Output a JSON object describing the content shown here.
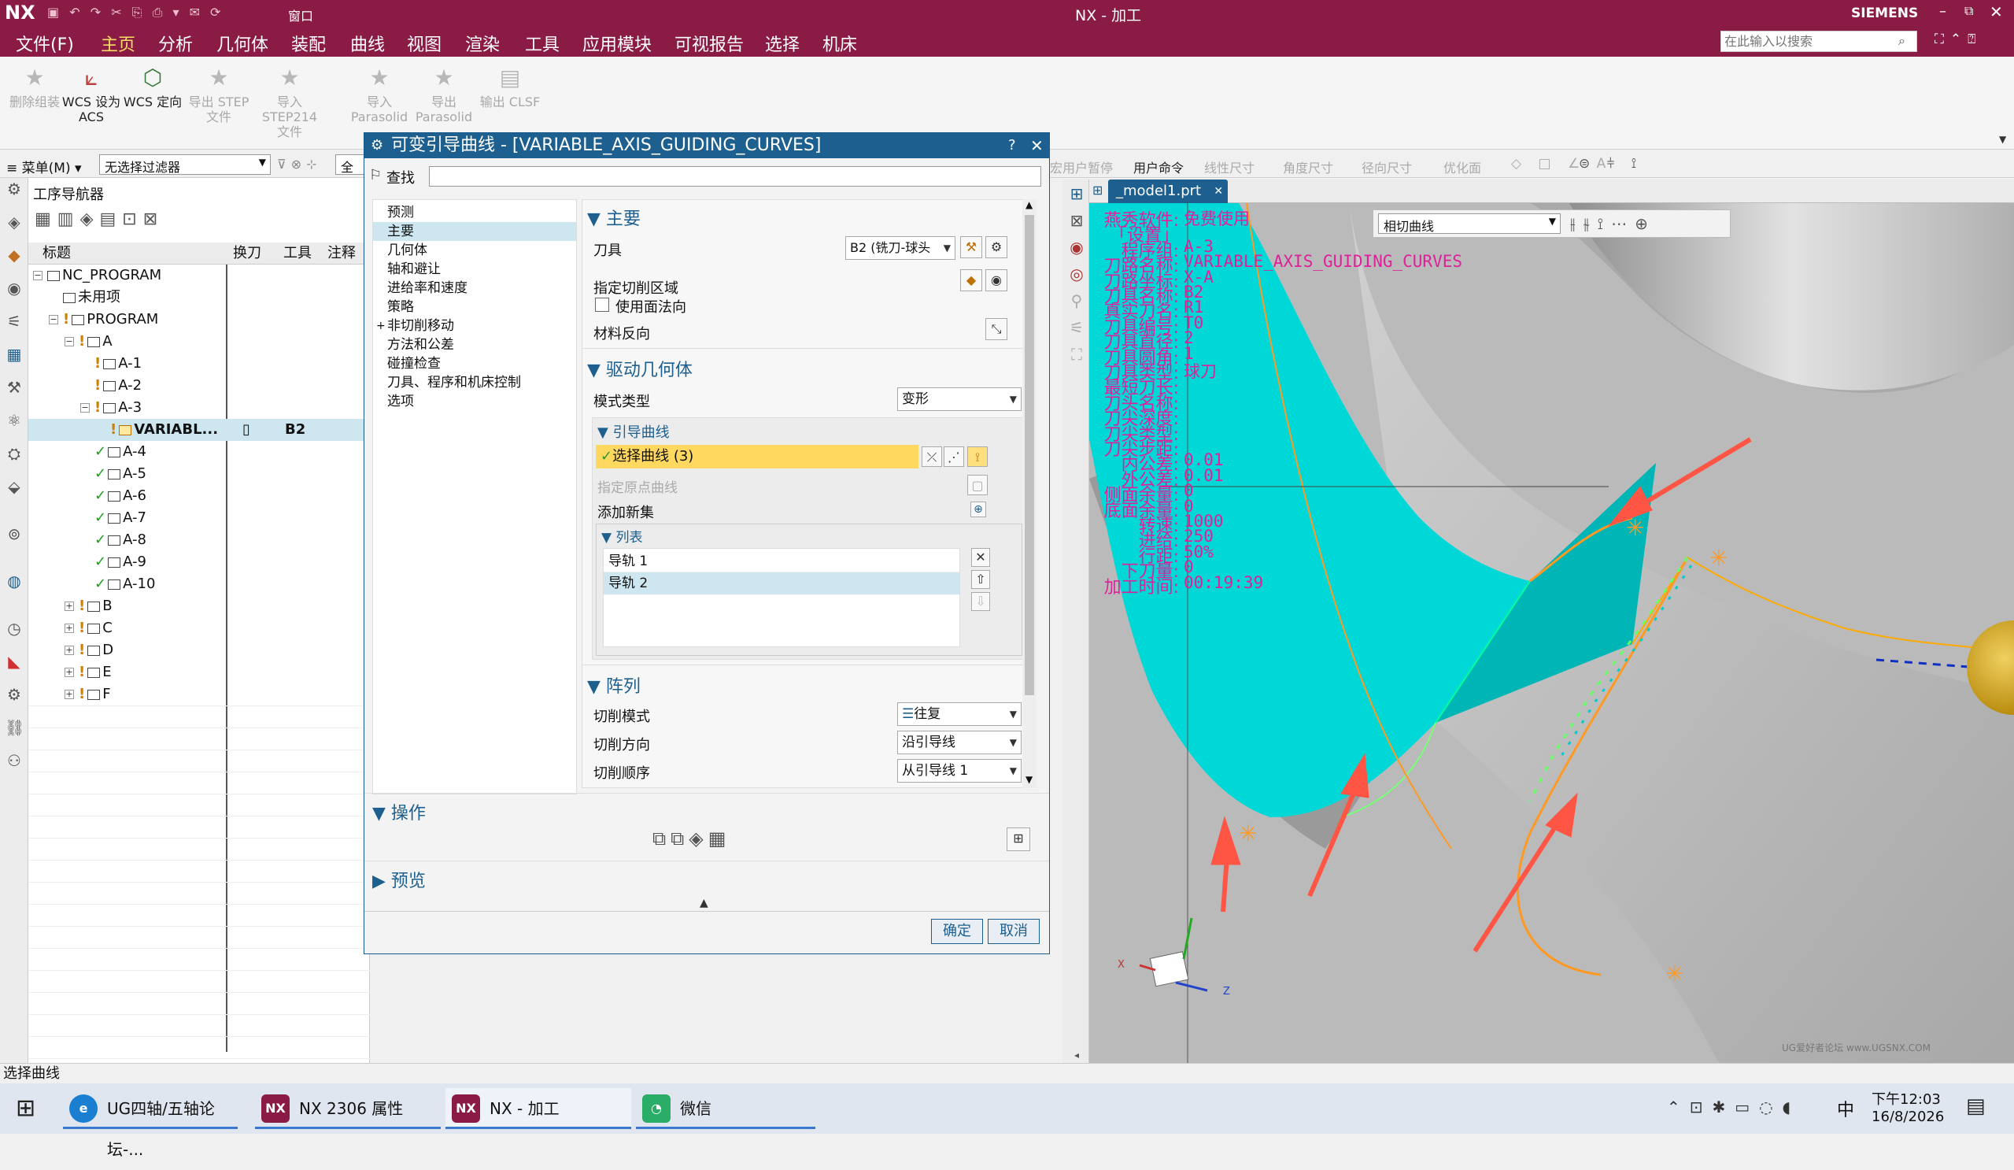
{
  "title": {
    "logo": "NX",
    "window_title": "NX - 加工",
    "brand": "SIEMENS",
    "window_menu": "窗口"
  },
  "menubar": {
    "items": [
      "文件(F)",
      "主页",
      "分析",
      "几何体",
      "装配",
      "曲线",
      "视图",
      "渲染",
      "工具",
      "应用模块",
      "可视报告",
      "选择",
      "机床"
    ],
    "search_placeholder": "在此输入以搜索"
  },
  "ribbon": {
    "buttons": [
      {
        "label": "删除组装",
        "icon": "star-icon",
        "enabled": false
      },
      {
        "label": "WCS 设为 ACS",
        "icon": "wcs-icon",
        "enabled": true
      },
      {
        "label": "WCS 定向",
        "icon": "wcs-orient-icon",
        "enabled": true
      },
      {
        "label": "导出 STEP 文件",
        "icon": "star-icon",
        "enabled": false
      },
      {
        "label": "导入 STEP214 文件",
        "icon": "star-icon",
        "enabled": false
      },
      {
        "label": "导入 Parasolid",
        "icon": "star-icon",
        "enabled": false
      },
      {
        "label": "导出 Parasolid",
        "icon": "star-icon",
        "enabled": false
      },
      {
        "label": "输出 CLSF",
        "icon": "clsf-icon",
        "enabled": false
      }
    ]
  },
  "filterbar": {
    "menu": "菜单(M)",
    "filter": "无选择过滤器",
    "scope": "全部",
    "right_items": [
      "宏用户暂停",
      "用户命令",
      "线性尺寸",
      "角度尺寸",
      "径向尺寸",
      "优化面"
    ]
  },
  "navigator": {
    "title": "工序导航器",
    "columns": [
      "标题",
      "换刀",
      "工具",
      "注释"
    ],
    "rows": [
      {
        "label": "NC_PROGRAM",
        "indent": 0,
        "toggle": "−",
        "mark": "",
        "tool": "",
        "change": ""
      },
      {
        "label": "未用项",
        "indent": 1,
        "toggle": "",
        "mark": "",
        "tool": "",
        "change": ""
      },
      {
        "label": "PROGRAM",
        "indent": 1,
        "toggle": "−",
        "mark": "!",
        "tool": "",
        "change": ""
      },
      {
        "label": "A",
        "indent": 2,
        "toggle": "−",
        "mark": "!",
        "tool": "",
        "change": ""
      },
      {
        "label": "A-1",
        "indent": 3,
        "toggle": "",
        "mark": "!",
        "tool": "",
        "change": ""
      },
      {
        "label": "A-2",
        "indent": 3,
        "toggle": "",
        "mark": "!",
        "tool": "",
        "change": ""
      },
      {
        "label": "A-3",
        "indent": 3,
        "toggle": "−",
        "mark": "!",
        "tool": "",
        "change": ""
      },
      {
        "label": "VARIABL...",
        "indent": 4,
        "toggle": "",
        "mark": "!",
        "tool": "B2",
        "change": "▯",
        "selected": true
      },
      {
        "label": "A-4",
        "indent": 3,
        "toggle": "",
        "mark": "✓",
        "tool": "",
        "change": ""
      },
      {
        "label": "A-5",
        "indent": 3,
        "toggle": "",
        "mark": "✓",
        "tool": "",
        "change": ""
      },
      {
        "label": "A-6",
        "indent": 3,
        "toggle": "",
        "mark": "✓",
        "tool": "",
        "change": ""
      },
      {
        "label": "A-7",
        "indent": 3,
        "toggle": "",
        "mark": "✓",
        "tool": "",
        "change": ""
      },
      {
        "label": "A-8",
        "indent": 3,
        "toggle": "",
        "mark": "✓",
        "tool": "",
        "change": ""
      },
      {
        "label": "A-9",
        "indent": 3,
        "toggle": "",
        "mark": "✓",
        "tool": "",
        "change": ""
      },
      {
        "label": "A-10",
        "indent": 3,
        "toggle": "",
        "mark": "✓",
        "tool": "",
        "change": ""
      },
      {
        "label": "B",
        "indent": 2,
        "toggle": "+",
        "mark": "!",
        "tool": "",
        "change": ""
      },
      {
        "label": "C",
        "indent": 2,
        "toggle": "+",
        "mark": "!",
        "tool": "",
        "change": ""
      },
      {
        "label": "D",
        "indent": 2,
        "toggle": "+",
        "mark": "!",
        "tool": "",
        "change": ""
      },
      {
        "label": "E",
        "indent": 2,
        "toggle": "+",
        "mark": "!",
        "tool": "",
        "change": ""
      },
      {
        "label": "F",
        "indent": 2,
        "toggle": "+",
        "mark": "!",
        "tool": "",
        "change": ""
      }
    ]
  },
  "dialog": {
    "title": "可变引导曲线 - [VARIABLE_AXIS_GUIDING_CURVES]",
    "search_label": "查找",
    "nav_items": [
      "预测",
      "主要",
      "几何体",
      "轴和避让",
      "进给率和速度",
      "策略",
      "非切削移动",
      "方法和公差",
      "碰撞检查",
      "刀具、程序和机床控制",
      "选项"
    ],
    "main": {
      "header": "主要",
      "tool_label": "刀具",
      "tool_value": "B2 (铣刀-球头",
      "cut_region": "指定切削区域",
      "use_face_normal": "使用面法向",
      "material_reverse": "材料反向"
    },
    "drive": {
      "header": "驱动几何体",
      "mode_label": "模式类型",
      "mode_value": "变形",
      "guide_header": "引导曲线",
      "select_curve": "选择曲线 (3)",
      "origin_curve": "指定原点曲线",
      "add_new_set": "添加新集",
      "list_header": "列表",
      "list_items": [
        "导轨  1",
        "导轨  2"
      ]
    },
    "array": {
      "header": "阵列",
      "cut_mode_label": "切削模式",
      "cut_mode_value": "往复",
      "cut_dir_label": "切削方向",
      "cut_dir_value": "沿引导线",
      "cut_order_label": "切削顺序",
      "cut_order_value": "从引导线 1"
    },
    "ops_header": "操作",
    "preview_header": "预览",
    "ok": "确定",
    "cancel": "取消"
  },
  "graphics": {
    "tab": "_model1.prt",
    "filter_dropdown": "相切曲线",
    "info": [
      {
        "k": "燕秀软件:",
        "v": "免费使用"
      },
      {
        "k": "「设置」",
        "v": ""
      },
      {
        "k": "程序组:",
        "v": "A-3"
      },
      {
        "k": "刀路名称:",
        "v": "VARIABLE_AXIS_GUIDING_CURVES"
      },
      {
        "k": "刀路坐标:",
        "v": "X-A"
      },
      {
        "k": "刀具名称:",
        "v": "B2"
      },
      {
        "k": "真实刀名:",
        "v": "R1"
      },
      {
        "k": "刀具编号:",
        "v": "T0"
      },
      {
        "k": "刀具直径:",
        "v": "2"
      },
      {
        "k": "刀具圆角:",
        "v": "1"
      },
      {
        "k": "刀具类型:",
        "v": "球刀"
      },
      {
        "k": "最短刀长:",
        "v": ""
      },
      {
        "k": "刀头名称:",
        "v": ""
      },
      {
        "k": "刀尖深度:",
        "v": ""
      },
      {
        "k": "刀尖类型:",
        "v": ""
      },
      {
        "k": "刀尖步距:",
        "v": ""
      },
      {
        "k": "内公差:",
        "v": "0.01"
      },
      {
        "k": "外公差:",
        "v": "0.01"
      },
      {
        "k": "侧面余量:",
        "v": "0"
      },
      {
        "k": "底面余量:",
        "v": "0"
      },
      {
        "k": "转速:",
        "v": "1000"
      },
      {
        "k": "进给:",
        "v": "250"
      },
      {
        "k": "行距:",
        "v": "50%"
      },
      {
        "k": "下刀量:",
        "v": "0"
      },
      {
        "k": "加工时间:",
        "v": "00:19:39"
      }
    ],
    "axis_x": "X",
    "axis_z": "Z",
    "watermark": "UG爱好者论坛 www.UGSNX.COM"
  },
  "status": "选择曲线",
  "taskbar": {
    "items": [
      "UG四轴/五轴论坛-...",
      "NX 2306 属性",
      "NX - 加工",
      "微信"
    ],
    "ime": "中",
    "time": "下午12:03",
    "date": "16/8/2026"
  },
  "colors": {
    "titlebar": "#8a1b44",
    "dialog_title": "#1d5f8e",
    "info_text": "#e0209a",
    "toolpath": "#00e0e0",
    "highlight": "#ffdd66"
  }
}
